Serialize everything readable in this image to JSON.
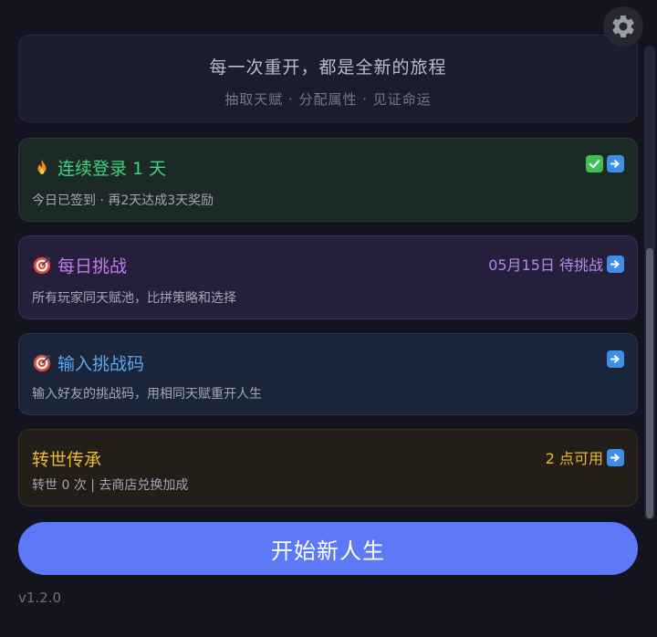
{
  "intro": {
    "tagline": "每一次重开，都是全新的旅程",
    "subtitle": "抽取天赋 · 分配属性 · 见证命运"
  },
  "streak": {
    "title": "连续登录 1 天",
    "description": "今日已签到 · 再2天达成3天奖励",
    "icon": "fire-icon"
  },
  "daily_challenge": {
    "title": "每日挑战",
    "status": "05月15日 待挑战",
    "description": "所有玩家同天赋池，比拼策略和选择",
    "icon": "target-icon"
  },
  "challenge_code": {
    "title": "输入挑战码",
    "description": "输入好友的挑战码，用相同天赋重开人生",
    "icon": "target-icon"
  },
  "rebirth": {
    "title": "转世传承",
    "points": "2 点可用",
    "description": "转世 0 次 | 去商店兑换加成"
  },
  "start_button": {
    "label": "开始新人生"
  },
  "version": "v1.2.0",
  "colors": {
    "background": "#13141f",
    "primary_button": "#5d79f7",
    "streak_green": "#3fd483",
    "daily_purple": "#c07cf0",
    "code_blue": "#5aa8f2",
    "rebirth_gold": "#ecbc2e"
  }
}
